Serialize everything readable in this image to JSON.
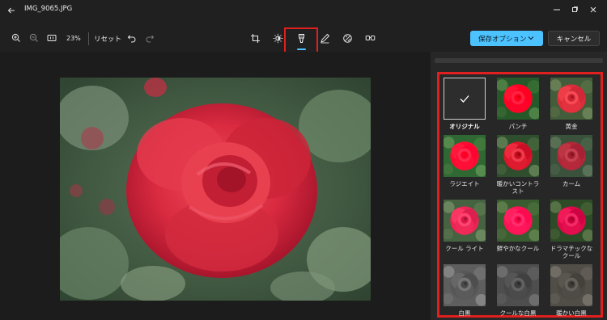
{
  "titlebar": {
    "title": "IMG_9065.JPG"
  },
  "toolbar": {
    "zoom_value": "23%",
    "reset_label": "リセット",
    "save_label": "保存オプション",
    "cancel_label": "キャンセル"
  },
  "filters": {
    "items": [
      {
        "label": "オリジナル",
        "selected": true
      },
      {
        "label": "パンチ"
      },
      {
        "label": "黄金"
      },
      {
        "label": "ラジエイト"
      },
      {
        "label": "暖かいコントラスト"
      },
      {
        "label": "カーム"
      },
      {
        "label": "クール ライト"
      },
      {
        "label": "鮮やかなクール"
      },
      {
        "label": "ドラマチックなクール"
      },
      {
        "label": "白黒"
      },
      {
        "label": "クールな白黒"
      },
      {
        "label": "暖かい白黒"
      }
    ]
  },
  "colors": {
    "accent": "#4cc2ff",
    "highlight": "#e0201e",
    "background": "#202020",
    "panel": "#272727"
  },
  "icons": [
    "back-arrow-icon",
    "minimize-icon",
    "maximize-icon",
    "close-icon",
    "zoom-in-icon",
    "zoom-out-icon",
    "actual-size-icon",
    "undo-icon",
    "redo-icon",
    "crop-icon",
    "adjust-icon",
    "filter-icon",
    "markup-icon",
    "retouch-icon",
    "red-eye-icon",
    "chevron-down-icon",
    "checkmark-icon"
  ]
}
